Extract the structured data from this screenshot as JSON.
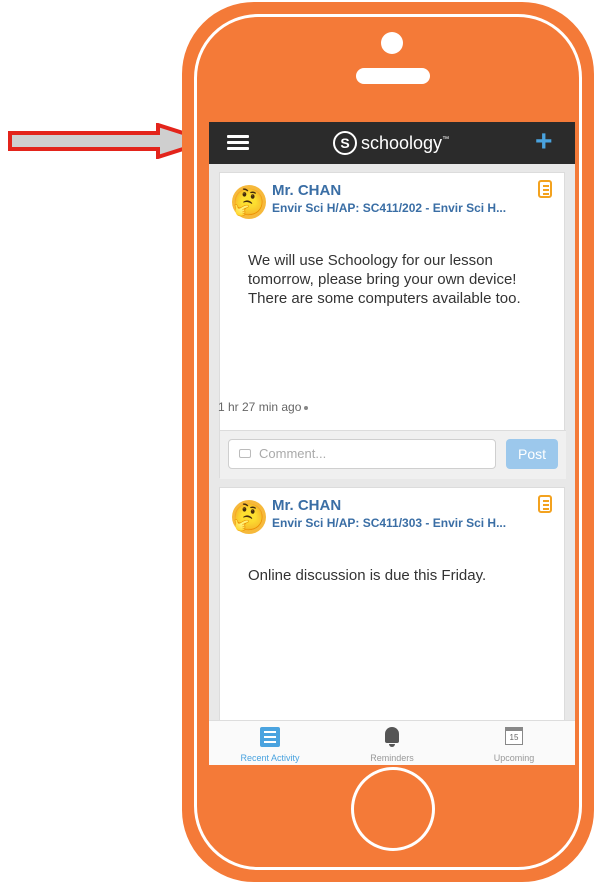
{
  "app": {
    "logo_text": "schoology",
    "logo_tm": "™",
    "logo_s": "S"
  },
  "posts": [
    {
      "author": "Mr. CHAN",
      "section": "Envir Sci H/AP: SC411/202 - Envir Sci H...",
      "body": "We will use Schoology for our lesson tomorrow, please bring your own device! There are some computers available too.",
      "time": "1 hr 27 min ago",
      "comment_placeholder": "Comment...",
      "post_label": "Post"
    },
    {
      "author": "Mr. CHAN",
      "section": "Envir Sci H/AP: SC411/303 - Envir Sci H...",
      "body": "Online discussion is due this Friday."
    }
  ],
  "tabs": [
    {
      "label": "Recent Activity",
      "icon": "list-icon",
      "active": true
    },
    {
      "label": "Reminders",
      "icon": "bell-icon",
      "active": false
    },
    {
      "label": "Upcoming",
      "icon": "calendar-icon",
      "active": false,
      "date": "15"
    }
  ],
  "colors": {
    "phone": "#f47a38",
    "topbar": "#2b2b2b",
    "accent": "#4aa3df",
    "link": "#3a6ea5",
    "arrow": "#e3241b"
  }
}
